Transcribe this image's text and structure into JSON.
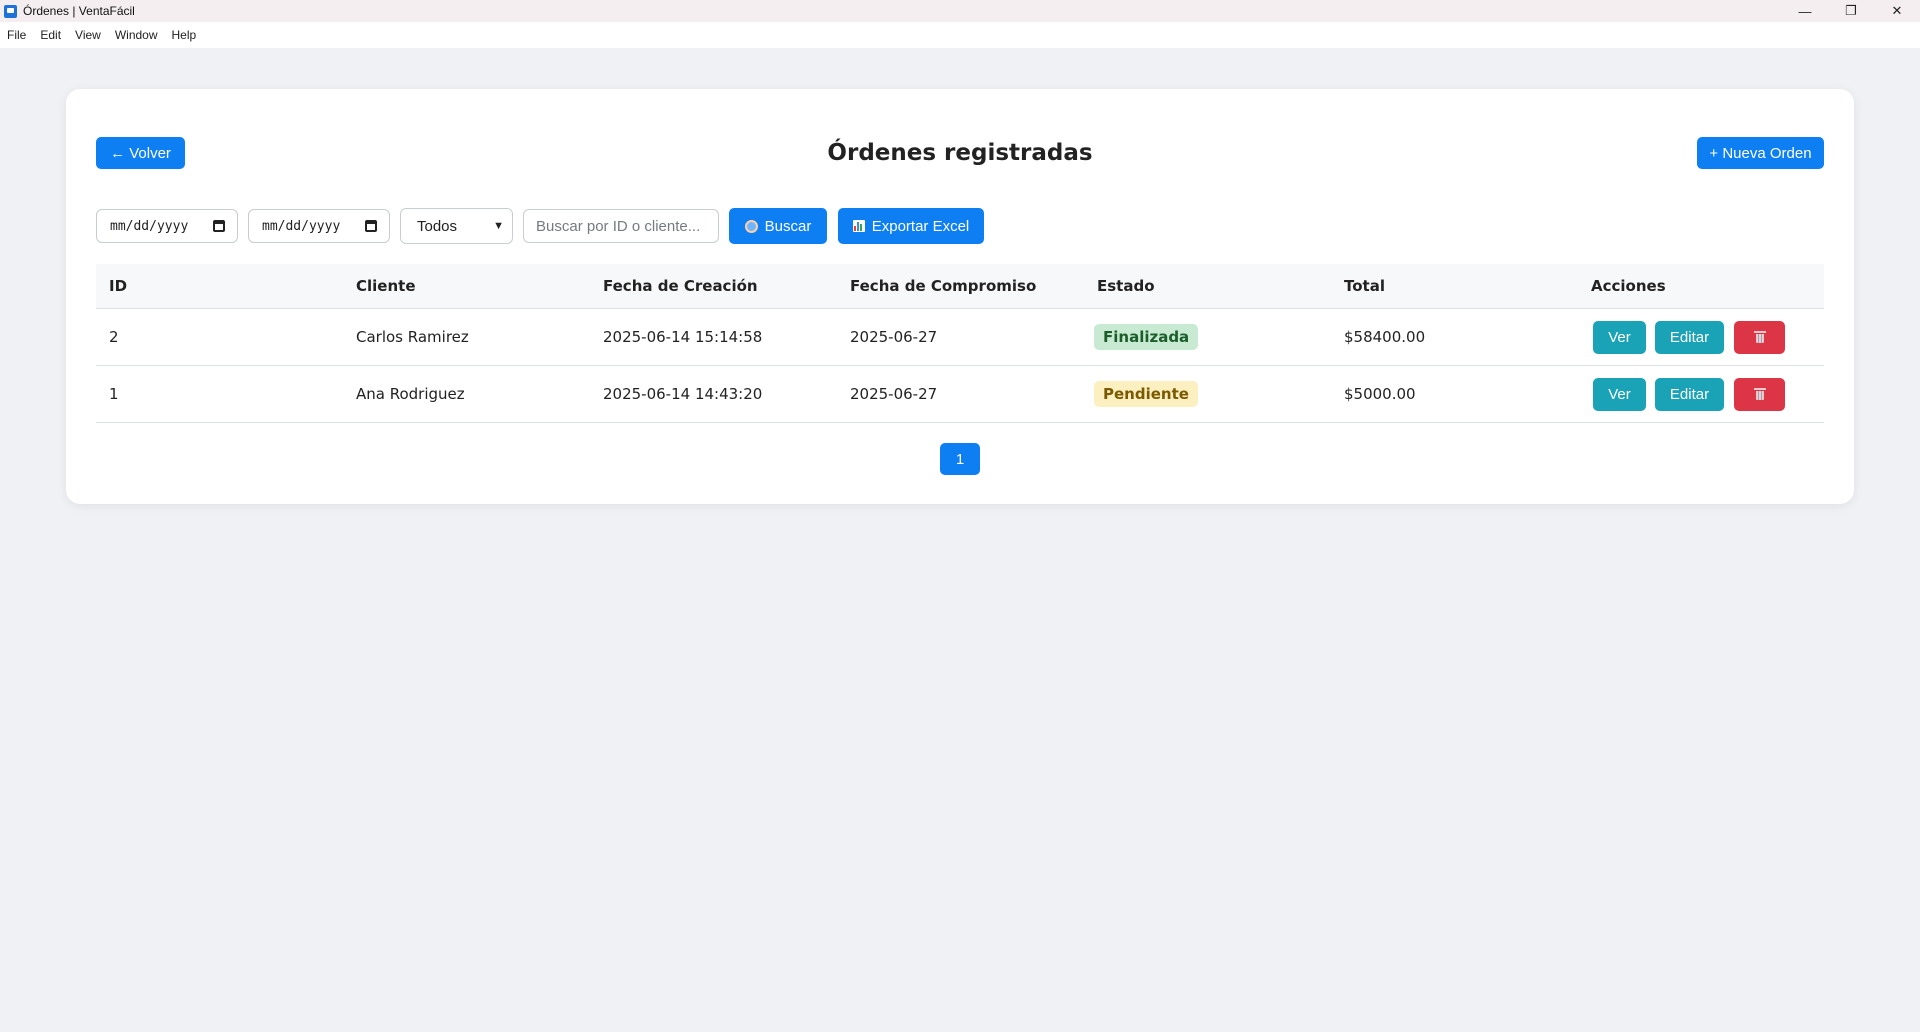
{
  "window": {
    "title": "Órdenes | VentaFácil",
    "minimize": "—",
    "maximize": "❐",
    "close": "✕"
  },
  "menu": [
    "File",
    "Edit",
    "View",
    "Window",
    "Help"
  ],
  "header": {
    "back_label": "← Volver",
    "title": "Órdenes registradas",
    "new_label": "+ Nueva Orden"
  },
  "filters": {
    "date_from": "mm/dd/yyyy",
    "date_to": "mm/dd/yyyy",
    "status_selected": "Todos",
    "search_placeholder": "Buscar por ID o cliente...",
    "search_label": "Buscar",
    "export_label": "Exportar Excel"
  },
  "table": {
    "columns": [
      "ID",
      "Cliente",
      "Fecha de Creación",
      "Fecha de Compromiso",
      "Estado",
      "Total",
      "Acciones"
    ],
    "rows": [
      {
        "id": "2",
        "cliente": "Carlos Ramirez",
        "creacion": "2025-06-14 15:14:58",
        "compromiso": "2025-06-27",
        "estado": "Finalizada",
        "total": "$58400.00"
      },
      {
        "id": "1",
        "cliente": "Ana Rodriguez",
        "creacion": "2025-06-14 14:43:20",
        "compromiso": "2025-06-27",
        "estado": "Pendiente",
        "total": "$5000.00"
      }
    ],
    "actions": {
      "view": "Ver",
      "edit": "Editar"
    }
  },
  "pagination": {
    "current": "1"
  },
  "colors": {
    "primary": "#0d7ff2",
    "info": "#1aa2b6",
    "danger": "#dc3545",
    "finalizada_bg": "#c8ead2",
    "pendiente_bg": "#fcefc0"
  }
}
